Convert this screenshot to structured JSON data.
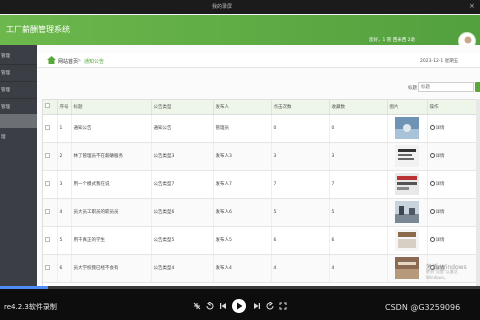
{
  "player": {
    "title": "我的录屏",
    "close_glyph": "×",
    "recorder_label": "re4.2.3软件录制",
    "csdn": "CSDN @G3259096",
    "progress": 0.1
  },
  "app": {
    "system_title": "工厂薪酬管理系统",
    "header_user": "您好，1  管 西米西 2退",
    "breadcrumb": {
      "home": "网站首页",
      "sep": ">",
      "current": "通知公告"
    },
    "current_time": "2023-12-1 星期五",
    "search": {
      "label": "标题",
      "placeholder": "标题"
    },
    "sidebar": {
      "items": [
        {
          "label": "管理"
        },
        {
          "label": "管理"
        },
        {
          "label": "管理"
        },
        {
          "label": "管理"
        },
        {
          "label": ""
        },
        {
          "label": "理"
        }
      ]
    },
    "table": {
      "headers": [
        "",
        "序号",
        "标题",
        "公告类型",
        "发布人",
        "点击次数",
        "收藏数",
        "图片",
        "操作"
      ],
      "rows": [
        {
          "no": "1",
          "title": "通知公告",
          "type": "通知公告",
          "publisher": "管理员",
          "clicks": "0",
          "favs": "0",
          "action": "详情"
        },
        {
          "no": "2",
          "title": "林了管理员不在薪酬服务",
          "type": "公告类型3",
          "publisher": "发布人3",
          "clicks": "3",
          "favs": "3",
          "action": "详情"
        },
        {
          "no": "3",
          "title": "用一个模式我在说",
          "type": "公告类型7",
          "publisher": "发布人7",
          "clicks": "7",
          "favs": "7",
          "action": "详情"
        },
        {
          "no": "4",
          "title": "员大员工职员的职员员",
          "type": "公告类型6",
          "publisher": "发布人6",
          "clicks": "5",
          "favs": "5",
          "action": "详情"
        },
        {
          "no": "5",
          "title": "用干真正的学生",
          "type": "公告类型5",
          "publisher": "发布人5",
          "clicks": "6",
          "favs": "6",
          "action": "详情"
        },
        {
          "no": "6",
          "title": "员大学校我已经不会有",
          "type": "公告类型4",
          "publisher": "发布人4",
          "clicks": "4",
          "favs": "4",
          "action": "详情"
        }
      ]
    },
    "watermark": {
      "line1": "激活 Windows",
      "line2": "转到\"设置\"以激活 Windows。"
    }
  },
  "colors": {
    "accent": "#59a83c",
    "header": "#6db84c",
    "sidebar": "#3b3f45"
  }
}
